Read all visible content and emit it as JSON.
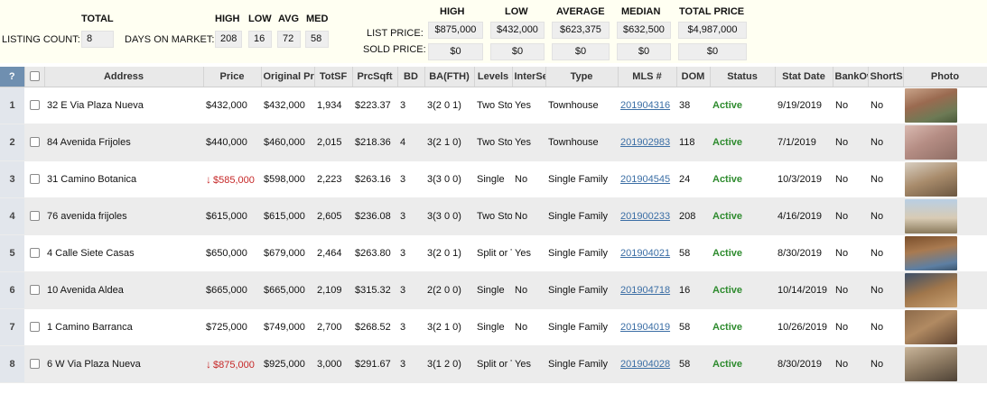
{
  "summary": {
    "total_header": "TOTAL",
    "listing_count_label": "LISTING COUNT:",
    "listing_count": "8",
    "dom_label": "DAYS ON MARKET:",
    "dom_headers": [
      "HIGH",
      "LOW",
      "AVG",
      "MED"
    ],
    "dom_values": [
      "208",
      "16",
      "72",
      "58"
    ],
    "price_headers": [
      "HIGH",
      "LOW",
      "AVERAGE",
      "MEDIAN",
      "TOTAL PRICE"
    ],
    "list_price_label": "LIST PRICE:",
    "list_price_values": [
      "$875,000",
      "$432,000",
      "$623,375",
      "$632,500",
      "$4,987,000"
    ],
    "sold_price_label": "SOLD PRICE:",
    "sold_price_values": [
      "$0",
      "$0",
      "$0",
      "$0",
      "$0"
    ]
  },
  "table": {
    "columns": [
      "?",
      "",
      "Address",
      "Price",
      "Original Price",
      "TotSF",
      "PrcSqft",
      "BD",
      "BA(FTH)",
      "Levels",
      "InterSec",
      "Type",
      "MLS #",
      "DOM",
      "Status",
      "Stat Date",
      "BankOwned",
      "ShortSale",
      "Photo"
    ],
    "rows": [
      {
        "num": "1",
        "address": "32 E Via Plaza Nueva",
        "price": "$432,000",
        "drop": false,
        "orig": "$432,000",
        "sf": "1,934",
        "psf": "$223.37",
        "bd": "3",
        "ba": "3(2 0 1)",
        "levels": "Two Story",
        "inter": "Yes",
        "type": "Townhouse",
        "mls": "201904316",
        "dom": "38",
        "status": "Active",
        "date": "9/19/2019",
        "bank": "No",
        "short": "No"
      },
      {
        "num": "2",
        "address": "84 Avenida Frijoles",
        "price": "$440,000",
        "drop": false,
        "orig": "$460,000",
        "sf": "2,015",
        "psf": "$218.36",
        "bd": "4",
        "ba": "3(2 1 0)",
        "levels": "Two Story",
        "inter": "Yes",
        "type": "Townhouse",
        "mls": "201902983",
        "dom": "118",
        "status": "Active",
        "date": "7/1/2019",
        "bank": "No",
        "short": "No"
      },
      {
        "num": "3",
        "address": "31 Camino Botanica",
        "price": "$585,000",
        "drop": true,
        "orig": "$598,000",
        "sf": "2,223",
        "psf": "$263.16",
        "bd": "3",
        "ba": "3(3 0 0)",
        "levels": "Single",
        "inter": "No",
        "type": "Single Family",
        "mls": "201904545",
        "dom": "24",
        "status": "Active",
        "date": "10/3/2019",
        "bank": "No",
        "short": "No"
      },
      {
        "num": "4",
        "address": "76 avenida frijoles",
        "price": "$615,000",
        "drop": false,
        "orig": "$615,000",
        "sf": "2,605",
        "psf": "$236.08",
        "bd": "3",
        "ba": "3(3 0 0)",
        "levels": "Two Story",
        "inter": "No",
        "type": "Single Family",
        "mls": "201900233",
        "dom": "208",
        "status": "Active",
        "date": "4/16/2019",
        "bank": "No",
        "short": "No"
      },
      {
        "num": "5",
        "address": "4 Calle Siete Casas",
        "price": "$650,000",
        "drop": false,
        "orig": "$679,000",
        "sf": "2,464",
        "psf": "$263.80",
        "bd": "3",
        "ba": "3(2 0 1)",
        "levels": "Split or Tri",
        "inter": "Yes",
        "type": "Single Family",
        "mls": "201904021",
        "dom": "58",
        "status": "Active",
        "date": "8/30/2019",
        "bank": "No",
        "short": "No"
      },
      {
        "num": "6",
        "address": "10 Avenida Aldea",
        "price": "$665,000",
        "drop": false,
        "orig": "$665,000",
        "sf": "2,109",
        "psf": "$315.32",
        "bd": "3",
        "ba": "2(2 0 0)",
        "levels": "Single",
        "inter": "No",
        "type": "Single Family",
        "mls": "201904718",
        "dom": "16",
        "status": "Active",
        "date": "10/14/2019",
        "bank": "No",
        "short": "No"
      },
      {
        "num": "7",
        "address": "1 Camino Barranca",
        "price": "$725,000",
        "drop": false,
        "orig": "$749,000",
        "sf": "2,700",
        "psf": "$268.52",
        "bd": "3",
        "ba": "3(2 1 0)",
        "levels": "Single",
        "inter": "No",
        "type": "Single Family",
        "mls": "201904019",
        "dom": "58",
        "status": "Active",
        "date": "10/26/2019",
        "bank": "No",
        "short": "No"
      },
      {
        "num": "8",
        "address": "6 W Via Plaza Nueva",
        "price": "$875,000",
        "drop": true,
        "orig": "$925,000",
        "sf": "3,000",
        "psf": "$291.67",
        "bd": "3",
        "ba": "3(1 2 0)",
        "levels": "Split or Tri",
        "inter": "Yes",
        "type": "Single Family",
        "mls": "201904028",
        "dom": "58",
        "status": "Active",
        "date": "8/30/2019",
        "bank": "No",
        "short": "No"
      }
    ]
  },
  "icons": {
    "price_drop": "down-arrow-icon",
    "photo": "property-photo-thumbnail"
  },
  "colors": {
    "status_active": "#2e8b2e",
    "price_drop": "#c62828",
    "link": "#3b6ea5",
    "summary_bg": "#fffff2",
    "corner_header": "#6f8fb0"
  }
}
